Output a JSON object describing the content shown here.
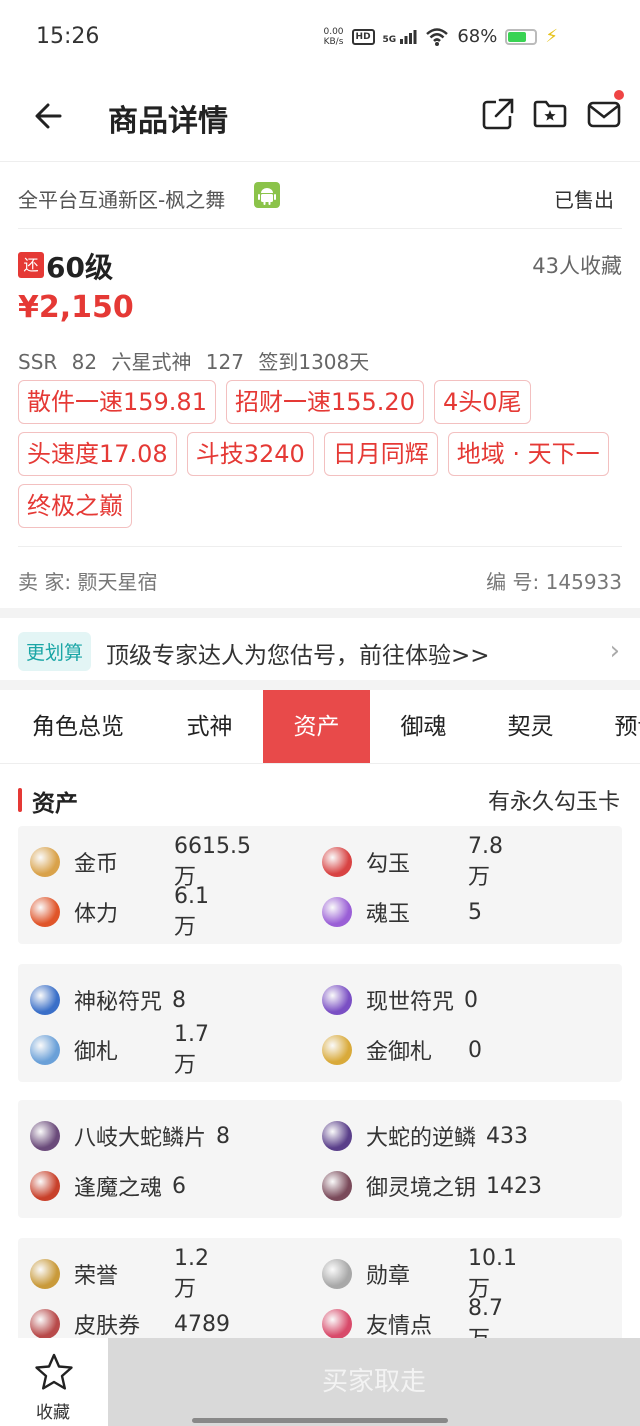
{
  "status_bar": {
    "time": "15:26",
    "net_speed_top": "0.00",
    "net_speed_bottom": "KB/s",
    "hd": "HD",
    "signal": "5G",
    "battery": "68%",
    "battery_level": 0.68,
    "icons": [
      "hd-icon",
      "signal-5g-icon",
      "wifi-icon",
      "battery-icon",
      "charging-icon"
    ]
  },
  "header": {
    "title": "商品详情",
    "icons": [
      "back-arrow-icon",
      "share-icon",
      "folder-star-icon",
      "message-icon"
    ]
  },
  "product": {
    "server": "全平台互通新区-枫之舞",
    "platform_icon": "android-icon",
    "status": "已售出",
    "return_badge": "还",
    "level": "60级",
    "favorites": "43人收藏",
    "price": "¥2,150",
    "stats": "SSR 82   六星式神 127   签到1308天",
    "tags": [
      "散件一速159.81",
      "招财一速155.20",
      "4头0尾",
      "头速度17.08",
      "斗技3240",
      "日月同辉",
      "地域 · 天下一",
      "终极之巅"
    ],
    "seller_label": "卖  家:",
    "seller_name": "颢天星宿",
    "id_label": "编  号:",
    "id_value": "145933"
  },
  "promo": {
    "badge": "更划算",
    "text": "顶级专家达人为您估号，前往体验>>",
    "arrow": "›"
  },
  "tabs": [
    "角色总览",
    "式神",
    "资产",
    "御魂",
    "契灵",
    "预设"
  ],
  "active_tab": "资产",
  "assets": {
    "title": "资产",
    "note": "有永久勾玉卡",
    "groups": [
      [
        {
          "label": "金币",
          "value": "6615.5万",
          "icon": "coin-icon",
          "color": "#d9a24a"
        },
        {
          "label": "勾玉",
          "value": "7.8万",
          "icon": "jade-icon",
          "color": "#d84343"
        },
        {
          "label": "体力",
          "value": "6.1万",
          "icon": "stamina-icon",
          "color": "#e0552a"
        },
        {
          "label": "魂玉",
          "value": "5",
          "icon": "soul-jade-icon",
          "color": "#9a5fd6"
        }
      ],
      [
        {
          "label": "神秘符咒",
          "value": "8",
          "icon": "mystery-charm-icon",
          "color": "#3a6fc8"
        },
        {
          "label": "现世符咒",
          "value": "0",
          "icon": "present-charm-icon",
          "color": "#7a4fc4"
        },
        {
          "label": "御札",
          "value": "1.7万",
          "icon": "amulet-icon",
          "color": "#6aa0d8"
        },
        {
          "label": "金御札",
          "value": "0",
          "icon": "gold-amulet-icon",
          "color": "#d9aa3a"
        }
      ],
      [
        {
          "label": "八岐大蛇鳞片",
          "value": "8",
          "icon": "orochi-scale-icon",
          "color": "#6a4a7a"
        },
        {
          "label": "大蛇的逆鳞",
          "value": "433",
          "icon": "reverse-scale-icon",
          "color": "#5a3f8a"
        },
        {
          "label": "逢魔之魂",
          "value": "6",
          "icon": "demon-soul-icon",
          "color": "#c8402a"
        },
        {
          "label": "御灵境之钥",
          "value": "1423",
          "icon": "spirit-key-icon",
          "color": "#7a4a5a"
        }
      ],
      [
        {
          "label": "荣誉",
          "value": "1.2万",
          "icon": "honor-icon",
          "color": "#c99a3a"
        },
        {
          "label": "勋章",
          "value": "10.1万",
          "icon": "medal-icon",
          "color": "#a8a8a8"
        },
        {
          "label": "皮肤券",
          "value": "4789",
          "icon": "skin-ticket-icon",
          "color": "#b84a4a"
        },
        {
          "label": "友情点",
          "value": "8.7万",
          "icon": "friendship-icon",
          "color": "#d84a6a"
        }
      ]
    ]
  },
  "bottom": {
    "favorite_label": "收藏",
    "buy_label": "买家取走"
  }
}
